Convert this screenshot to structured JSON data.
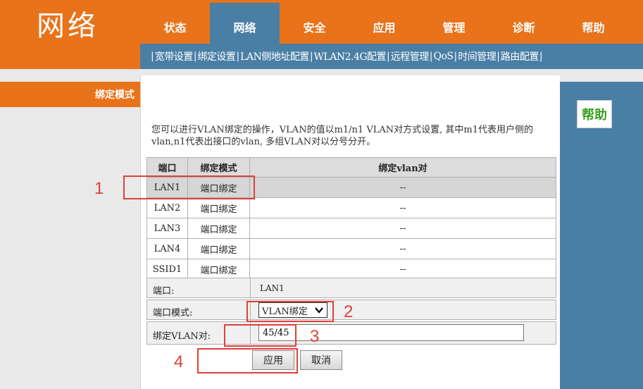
{
  "header": {
    "logo": "网络",
    "tabs": [
      {
        "label": "状态",
        "active": false
      },
      {
        "label": "网络",
        "active": true
      },
      {
        "label": "安全",
        "active": false
      },
      {
        "label": "应用",
        "active": false
      },
      {
        "label": "管理",
        "active": false
      },
      {
        "label": "诊断",
        "active": false
      },
      {
        "label": "帮助",
        "active": false
      }
    ],
    "subnav": [
      "宽带设置",
      "绑定设置",
      "LAN侧地址配置",
      "WLAN2.4G配置",
      "远程管理",
      "QoS",
      "时间管理",
      "路由配置"
    ]
  },
  "sidebar": {
    "label": "绑定模式"
  },
  "main": {
    "description": "您可以进行VLAN绑定的操作，VLAN的值以m1/n1 VLAN对方式设置, 其中m1代表用户侧的vlan,n1代表出接口的vlan, 多组VLAN对以分号分开。",
    "table": {
      "headers": [
        "端口",
        "绑定模式",
        "绑定vlan对"
      ],
      "rows": [
        {
          "port": "LAN1",
          "mode": "端口绑定",
          "vlan": "--",
          "selected": true
        },
        {
          "port": "LAN2",
          "mode": "端口绑定",
          "vlan": "--",
          "selected": false
        },
        {
          "port": "LAN3",
          "mode": "端口绑定",
          "vlan": "--",
          "selected": false
        },
        {
          "port": "LAN4",
          "mode": "端口绑定",
          "vlan": "--",
          "selected": false
        },
        {
          "port": "SSID1",
          "mode": "端口绑定",
          "vlan": "--",
          "selected": false
        }
      ]
    },
    "form": {
      "port_label": "端口:",
      "port_value": "LAN1",
      "mode_label": "端口模式:",
      "mode_value": "VLAN绑定",
      "vlan_label": "绑定VLAN对:",
      "vlan_value": "45/45"
    },
    "buttons": {
      "apply": "应用",
      "cancel": "取消"
    }
  },
  "help": {
    "label": "帮助"
  },
  "annotations": [
    "1",
    "2",
    "3",
    "4"
  ],
  "colors": {
    "orange": "#e8731a",
    "blue": "#4a7fa5",
    "annotation_red": "#e0403a",
    "help_green": "#3aa01d"
  }
}
